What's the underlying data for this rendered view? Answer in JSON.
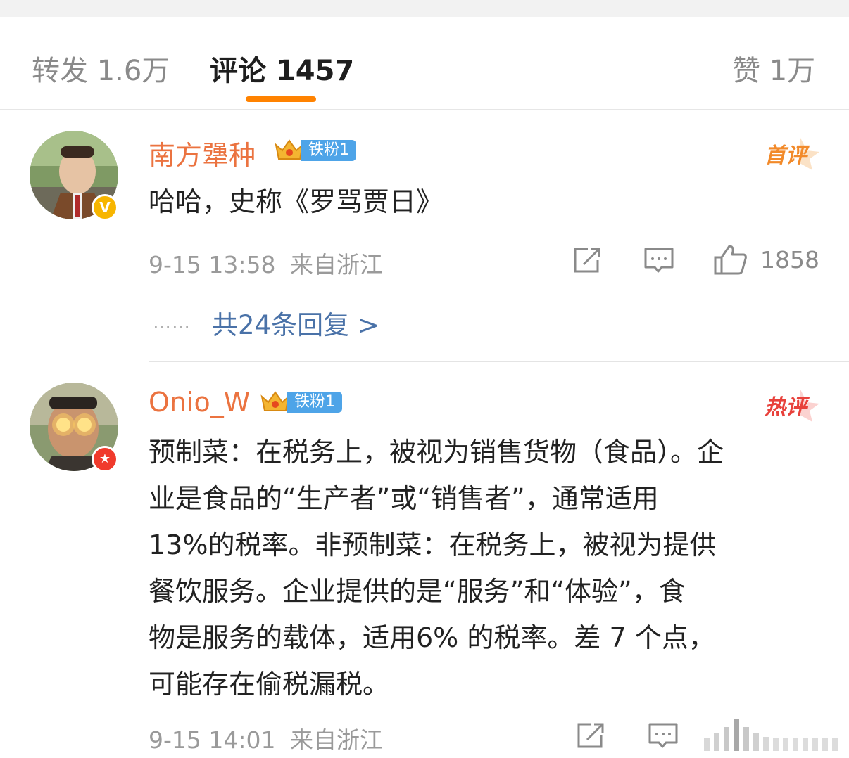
{
  "tabs": {
    "reposts": {
      "label": "转发",
      "count": "1.6万"
    },
    "comments": {
      "label": "评论",
      "count": "1457"
    },
    "likes": {
      "label": "赞",
      "count": "1万"
    }
  },
  "colors": {
    "accent": "#ff8200",
    "username": "#eb7340",
    "link": "#4a72a8",
    "fan_badge": "#4ea4e8",
    "first_tag": "#f28a2a",
    "hot_tag": "#e8413b"
  },
  "comments": [
    {
      "username": "南方犟种",
      "fan_badge": "铁粉1",
      "tag": "首评",
      "avatar_badge_icon": "verified-v-icon",
      "text": "哈哈，史称《罗骂贾日》",
      "time": "9-15 13:58",
      "location": "来自浙江",
      "likes": "1858",
      "replies_link": "共24条回复 >",
      "replies_dots": "……"
    },
    {
      "username": "Onio_W",
      "fan_badge": "铁粉1",
      "tag": "热评",
      "avatar_badge_icon": "star-badge-icon",
      "text_lines": [
        "预制菜：在税务上，被视为销售货物（食品）。企",
        "业是食品的“生产者”或“销售者”，通常适用",
        "13%的税率。非预制菜：在税务上，被视为提供",
        "餐饮服务。企业提供的是“服务”和“体验”，食",
        "物是服务的载体，适用6% 的税率。差 7 个点，",
        "可能存在偷税漏税。"
      ],
      "time": "9-15 14:01",
      "location": "来自浙江"
    }
  ],
  "icons": [
    "repost-icon",
    "comment-icon",
    "like-icon"
  ]
}
